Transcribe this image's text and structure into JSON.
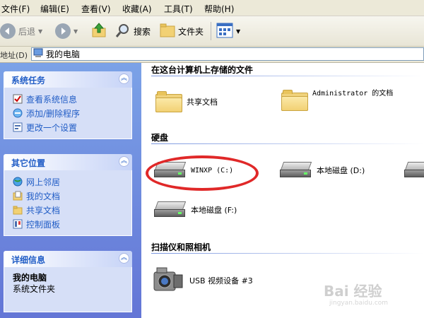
{
  "menu": [
    "文件(F)",
    "编辑(E)",
    "查看(V)",
    "收藏(A)",
    "工具(T)",
    "帮助(H)"
  ],
  "toolbar": {
    "back_label": "后退",
    "search_label": "搜索",
    "folders_label": "文件夹",
    "back_icon": "back-arrow-icon",
    "forward_icon": "forward-arrow-icon",
    "up_icon": "up-folder-icon",
    "views_icon": "views-grid-icon"
  },
  "address": {
    "label": "地址(D)",
    "value": "我的电脑"
  },
  "left": {
    "tasks": {
      "title": "系统任务",
      "items": [
        {
          "label": "查看系统信息",
          "icon": "system-info-icon"
        },
        {
          "label": "添加/删除程序",
          "icon": "add-remove-icon"
        },
        {
          "label": "更改一个设置",
          "icon": "settings-icon"
        }
      ]
    },
    "places": {
      "title": "其它位置",
      "items": [
        {
          "label": "网上邻居",
          "icon": "network-icon"
        },
        {
          "label": "我的文档",
          "icon": "documents-icon"
        },
        {
          "label": "共享文档",
          "icon": "folder-icon"
        },
        {
          "label": "控制面板",
          "icon": "control-panel-icon"
        }
      ]
    },
    "details": {
      "title": "详细信息",
      "name": "我的电脑",
      "desc": "系统文件夹"
    }
  },
  "main": {
    "files_title": "在这台计算机上存储的文件",
    "shared_docs": "共享文档",
    "admin_docs": "Administrator 的文档",
    "disks_title": "硬盘",
    "drive_c": "WINXP (C:)",
    "drive_d": "本地磁盘 (D:)",
    "drive_f": "本地磁盘 (F:)",
    "scanners_title": "扫描仪和照相机",
    "camera": "USB 视频设备 #3"
  },
  "watermark": {
    "brand": "Bai 经验",
    "url": "jingyan.baidu.com"
  },
  "colors": {
    "highlight_ring": "#e02828",
    "task_link": "#215dc6"
  }
}
